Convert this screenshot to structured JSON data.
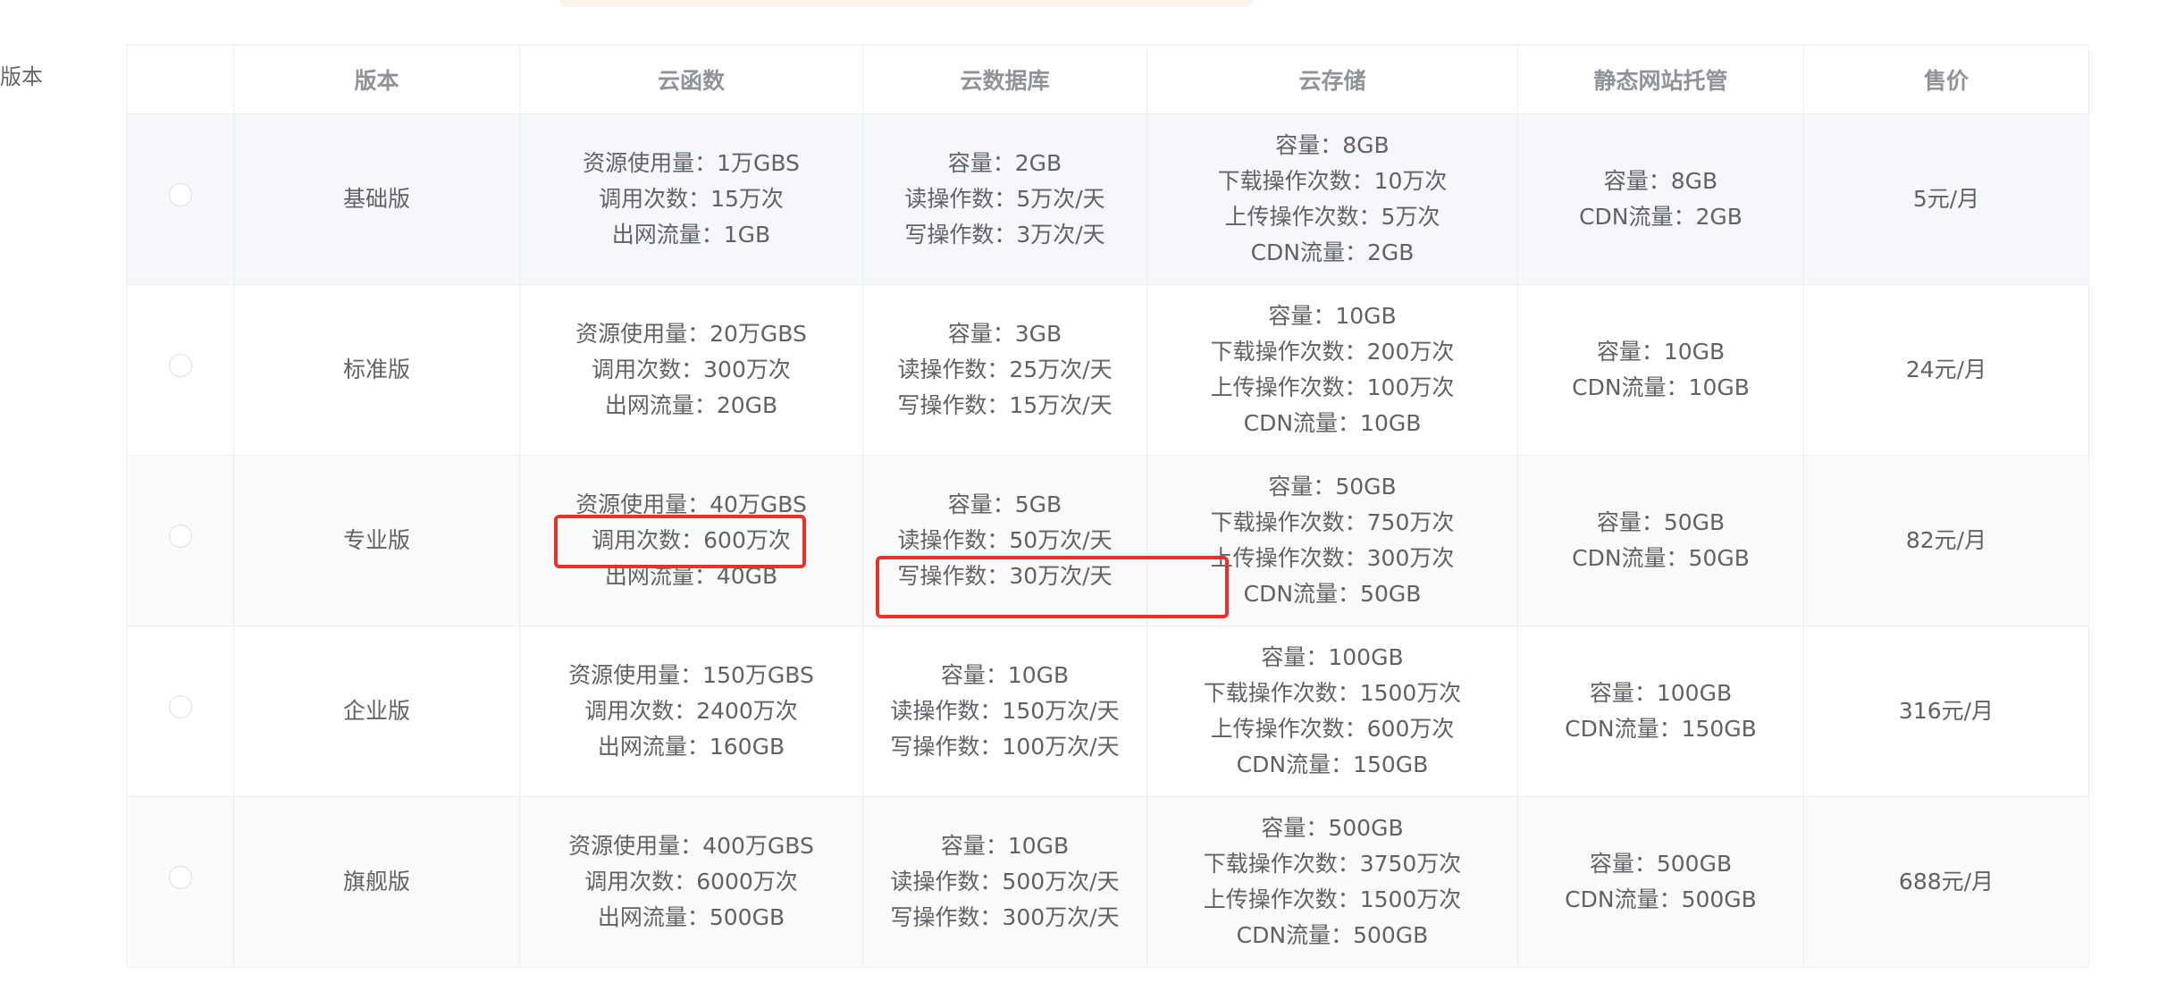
{
  "side_label": "版本",
  "columns": [
    "",
    "版本",
    "云函数",
    "云数据库",
    "云存储",
    "静态网站托管",
    "售价"
  ],
  "rows": [
    {
      "edition": "基础版",
      "functions": [
        "资源使用量：1万GBS",
        "调用次数：15万次",
        "出网流量：1GB"
      ],
      "database": [
        "容量：2GB",
        "读操作数：5万次/天",
        "写操作数：3万次/天"
      ],
      "storage": [
        "容量：8GB",
        "下载操作次数：10万次",
        "上传操作次数：5万次",
        "CDN流量：2GB"
      ],
      "hosting": [
        "容量：8GB",
        "CDN流量：2GB"
      ],
      "price": "5元/月"
    },
    {
      "edition": "标准版",
      "functions": [
        "资源使用量：20万GBS",
        "调用次数：300万次",
        "出网流量：20GB"
      ],
      "database": [
        "容量：3GB",
        "读操作数：25万次/天",
        "写操作数：15万次/天"
      ],
      "storage": [
        "容量：10GB",
        "下载操作次数：200万次",
        "上传操作次数：100万次",
        "CDN流量：10GB"
      ],
      "hosting": [
        "容量：10GB",
        "CDN流量：10GB"
      ],
      "price": "24元/月"
    },
    {
      "edition": "专业版",
      "functions": [
        "资源使用量：40万GBS",
        "调用次数：600万次",
        "出网流量：40GB"
      ],
      "database": [
        "容量：5GB",
        "读操作数：50万次/天",
        "写操作数：30万次/天"
      ],
      "storage": [
        "容量：50GB",
        "下载操作次数：750万次",
        "上传操作次数：300万次",
        "CDN流量：50GB"
      ],
      "hosting": [
        "容量：50GB",
        "CDN流量：50GB"
      ],
      "price": "82元/月"
    },
    {
      "edition": "企业版",
      "functions": [
        "资源使用量：150万GBS",
        "调用次数：2400万次",
        "出网流量：160GB"
      ],
      "database": [
        "容量：10GB",
        "读操作数：150万次/天",
        "写操作数：100万次/天"
      ],
      "storage": [
        "容量：100GB",
        "下载操作次数：1500万次",
        "上传操作次数：600万次",
        "CDN流量：150GB"
      ],
      "hosting": [
        "容量：100GB",
        "CDN流量：150GB"
      ],
      "price": "316元/月"
    },
    {
      "edition": "旗舰版",
      "functions": [
        "资源使用量：400万GBS",
        "调用次数：6000万次",
        "出网流量：500GB"
      ],
      "database": [
        "容量：10GB",
        "读操作数：500万次/天",
        "写操作数：300万次/天"
      ],
      "storage": [
        "容量：500GB",
        "下载操作次数：3750万次",
        "上传操作次数：1500万次",
        "CDN流量：500GB"
      ],
      "hosting": [
        "容量：500GB",
        "CDN流量：500GB"
      ],
      "price": "688元/月"
    }
  ],
  "colors": {
    "border": "#ebeef5",
    "header_text": "#909399",
    "cell_text": "#606266",
    "highlight": "#e8312b",
    "banner": "#fdf3ea"
  }
}
